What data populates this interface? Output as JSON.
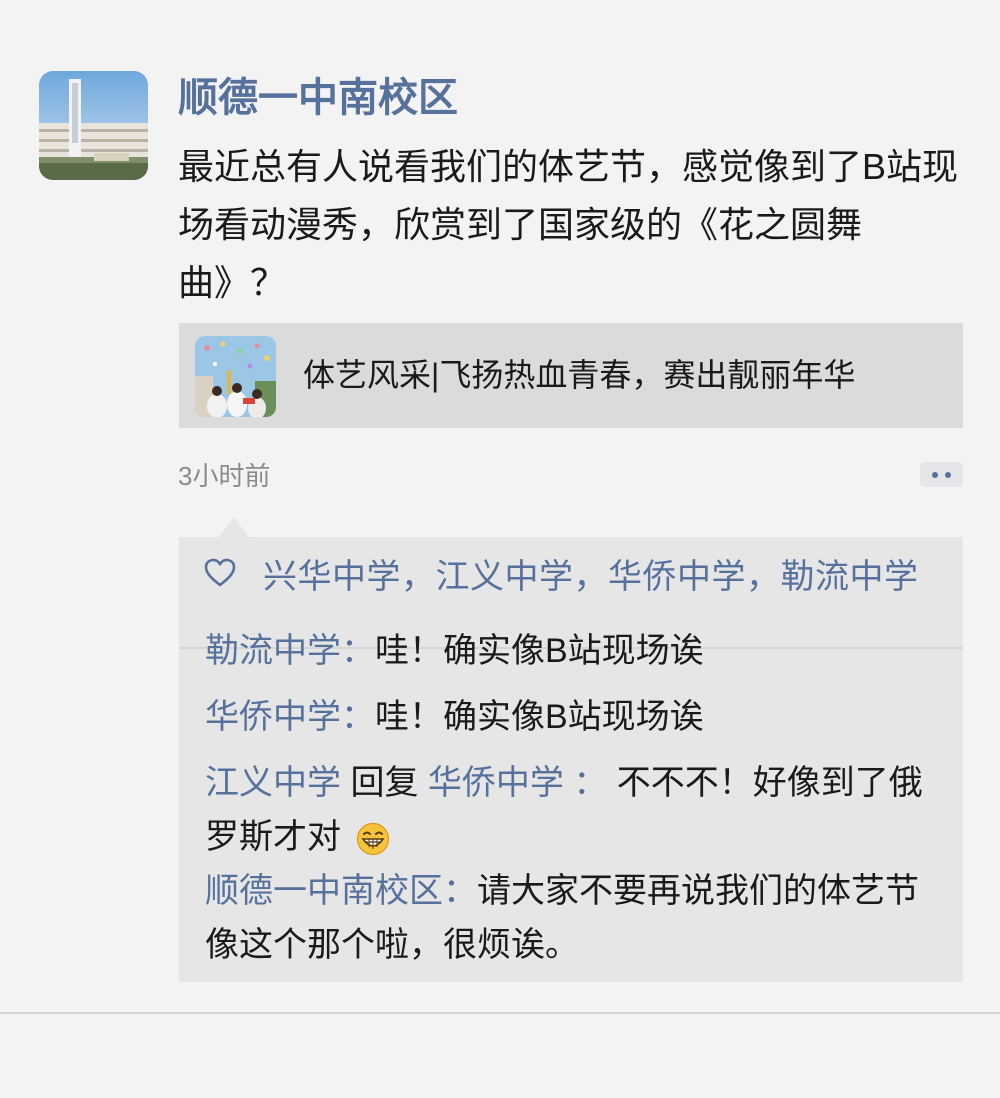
{
  "post": {
    "author": "顺德一中南校区",
    "text": "最近总有人说看我们的体艺节，感觉像到了B站现场看动漫秀，欣赏到了国家级的《花之圆舞曲》？",
    "link": {
      "title": "体艺风采|飞扬热血青春，赛出靓丽年华"
    },
    "time": "3小时前"
  },
  "likes": "兴华中学，江义中学，华侨中学，勒流中学",
  "comments": [
    {
      "name": "勒流中学",
      "sep": "：",
      "text": "哇！确实像B站现场诶"
    },
    {
      "name": "华侨中学",
      "sep": "：",
      "text": "哇！确实像B站现场诶"
    },
    {
      "name": "江义中学",
      "reply_word": " 回复 ",
      "reply_to": "华侨中学",
      "sep": " ：",
      "text": " 不不不！好像到了俄罗斯才对 ",
      "emoji": "grin-emoji"
    },
    {
      "name": "顺德一中南校区",
      "sep": "：",
      "text": "请大家不要再说我们的体艺节像这个那个啦，很烦诶。"
    }
  ],
  "colors": {
    "link": "#56719c",
    "background": "#f3f3f3",
    "comment_bg": "#e6e6e6"
  }
}
